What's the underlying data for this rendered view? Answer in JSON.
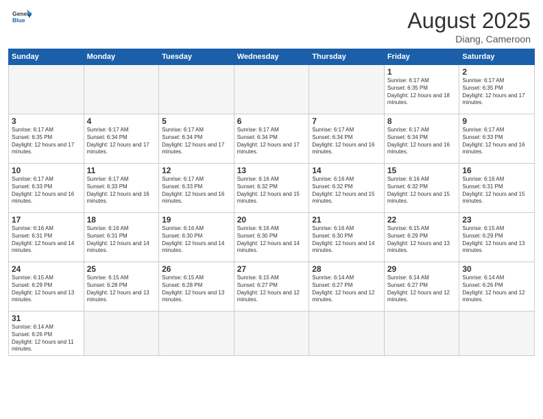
{
  "header": {
    "logo_general": "General",
    "logo_blue": "Blue",
    "month_year": "August 2025",
    "location": "Diang, Cameroon"
  },
  "days_of_week": [
    "Sunday",
    "Monday",
    "Tuesday",
    "Wednesday",
    "Thursday",
    "Friday",
    "Saturday"
  ],
  "weeks": [
    [
      {
        "day": "",
        "empty": true
      },
      {
        "day": "",
        "empty": true
      },
      {
        "day": "",
        "empty": true
      },
      {
        "day": "",
        "empty": true
      },
      {
        "day": "",
        "empty": true
      },
      {
        "day": "1",
        "sunrise": "Sunrise: 6:17 AM",
        "sunset": "Sunset: 6:35 PM",
        "daylight": "Daylight: 12 hours and 18 minutes."
      },
      {
        "day": "2",
        "sunrise": "Sunrise: 6:17 AM",
        "sunset": "Sunset: 6:35 PM",
        "daylight": "Daylight: 12 hours and 17 minutes."
      }
    ],
    [
      {
        "day": "3",
        "sunrise": "Sunrise: 6:17 AM",
        "sunset": "Sunset: 6:35 PM",
        "daylight": "Daylight: 12 hours and 17 minutes."
      },
      {
        "day": "4",
        "sunrise": "Sunrise: 6:17 AM",
        "sunset": "Sunset: 6:34 PM",
        "daylight": "Daylight: 12 hours and 17 minutes."
      },
      {
        "day": "5",
        "sunrise": "Sunrise: 6:17 AM",
        "sunset": "Sunset: 6:34 PM",
        "daylight": "Daylight: 12 hours and 17 minutes."
      },
      {
        "day": "6",
        "sunrise": "Sunrise: 6:17 AM",
        "sunset": "Sunset: 6:34 PM",
        "daylight": "Daylight: 12 hours and 17 minutes."
      },
      {
        "day": "7",
        "sunrise": "Sunrise: 6:17 AM",
        "sunset": "Sunset: 6:34 PM",
        "daylight": "Daylight: 12 hours and 16 minutes."
      },
      {
        "day": "8",
        "sunrise": "Sunrise: 6:17 AM",
        "sunset": "Sunset: 6:34 PM",
        "daylight": "Daylight: 12 hours and 16 minutes."
      },
      {
        "day": "9",
        "sunrise": "Sunrise: 6:17 AM",
        "sunset": "Sunset: 6:33 PM",
        "daylight": "Daylight: 12 hours and 16 minutes."
      }
    ],
    [
      {
        "day": "10",
        "sunrise": "Sunrise: 6:17 AM",
        "sunset": "Sunset: 6:33 PM",
        "daylight": "Daylight: 12 hours and 16 minutes."
      },
      {
        "day": "11",
        "sunrise": "Sunrise: 6:17 AM",
        "sunset": "Sunset: 6:33 PM",
        "daylight": "Daylight: 12 hours and 16 minutes."
      },
      {
        "day": "12",
        "sunrise": "Sunrise: 6:17 AM",
        "sunset": "Sunset: 6:33 PM",
        "daylight": "Daylight: 12 hours and 16 minutes."
      },
      {
        "day": "13",
        "sunrise": "Sunrise: 6:16 AM",
        "sunset": "Sunset: 6:32 PM",
        "daylight": "Daylight: 12 hours and 15 minutes."
      },
      {
        "day": "14",
        "sunrise": "Sunrise: 6:16 AM",
        "sunset": "Sunset: 6:32 PM",
        "daylight": "Daylight: 12 hours and 15 minutes."
      },
      {
        "day": "15",
        "sunrise": "Sunrise: 6:16 AM",
        "sunset": "Sunset: 6:32 PM",
        "daylight": "Daylight: 12 hours and 15 minutes."
      },
      {
        "day": "16",
        "sunrise": "Sunrise: 6:16 AM",
        "sunset": "Sunset: 6:31 PM",
        "daylight": "Daylight: 12 hours and 15 minutes."
      }
    ],
    [
      {
        "day": "17",
        "sunrise": "Sunrise: 6:16 AM",
        "sunset": "Sunset: 6:31 PM",
        "daylight": "Daylight: 12 hours and 14 minutes."
      },
      {
        "day": "18",
        "sunrise": "Sunrise: 6:16 AM",
        "sunset": "Sunset: 6:31 PM",
        "daylight": "Daylight: 12 hours and 14 minutes."
      },
      {
        "day": "19",
        "sunrise": "Sunrise: 6:16 AM",
        "sunset": "Sunset: 6:30 PM",
        "daylight": "Daylight: 12 hours and 14 minutes."
      },
      {
        "day": "20",
        "sunrise": "Sunrise: 6:16 AM",
        "sunset": "Sunset: 6:30 PM",
        "daylight": "Daylight: 12 hours and 14 minutes."
      },
      {
        "day": "21",
        "sunrise": "Sunrise: 6:16 AM",
        "sunset": "Sunset: 6:30 PM",
        "daylight": "Daylight: 12 hours and 14 minutes."
      },
      {
        "day": "22",
        "sunrise": "Sunrise: 6:15 AM",
        "sunset": "Sunset: 6:29 PM",
        "daylight": "Daylight: 12 hours and 13 minutes."
      },
      {
        "day": "23",
        "sunrise": "Sunrise: 6:15 AM",
        "sunset": "Sunset: 6:29 PM",
        "daylight": "Daylight: 12 hours and 13 minutes."
      }
    ],
    [
      {
        "day": "24",
        "sunrise": "Sunrise: 6:15 AM",
        "sunset": "Sunset: 6:29 PM",
        "daylight": "Daylight: 12 hours and 13 minutes."
      },
      {
        "day": "25",
        "sunrise": "Sunrise: 6:15 AM",
        "sunset": "Sunset: 6:28 PM",
        "daylight": "Daylight: 12 hours and 13 minutes."
      },
      {
        "day": "26",
        "sunrise": "Sunrise: 6:15 AM",
        "sunset": "Sunset: 6:28 PM",
        "daylight": "Daylight: 12 hours and 13 minutes."
      },
      {
        "day": "27",
        "sunrise": "Sunrise: 6:15 AM",
        "sunset": "Sunset: 6:27 PM",
        "daylight": "Daylight: 12 hours and 12 minutes."
      },
      {
        "day": "28",
        "sunrise": "Sunrise: 6:14 AM",
        "sunset": "Sunset: 6:27 PM",
        "daylight": "Daylight: 12 hours and 12 minutes."
      },
      {
        "day": "29",
        "sunrise": "Sunrise: 6:14 AM",
        "sunset": "Sunset: 6:27 PM",
        "daylight": "Daylight: 12 hours and 12 minutes."
      },
      {
        "day": "30",
        "sunrise": "Sunrise: 6:14 AM",
        "sunset": "Sunset: 6:26 PM",
        "daylight": "Daylight: 12 hours and 12 minutes."
      }
    ],
    [
      {
        "day": "31",
        "sunrise": "Sunrise: 6:14 AM",
        "sunset": "Sunset: 6:26 PM",
        "daylight": "Daylight: 12 hours and 11 minutes."
      },
      {
        "day": "",
        "empty": true
      },
      {
        "day": "",
        "empty": true
      },
      {
        "day": "",
        "empty": true
      },
      {
        "day": "",
        "empty": true
      },
      {
        "day": "",
        "empty": true
      },
      {
        "day": "",
        "empty": true
      }
    ]
  ]
}
